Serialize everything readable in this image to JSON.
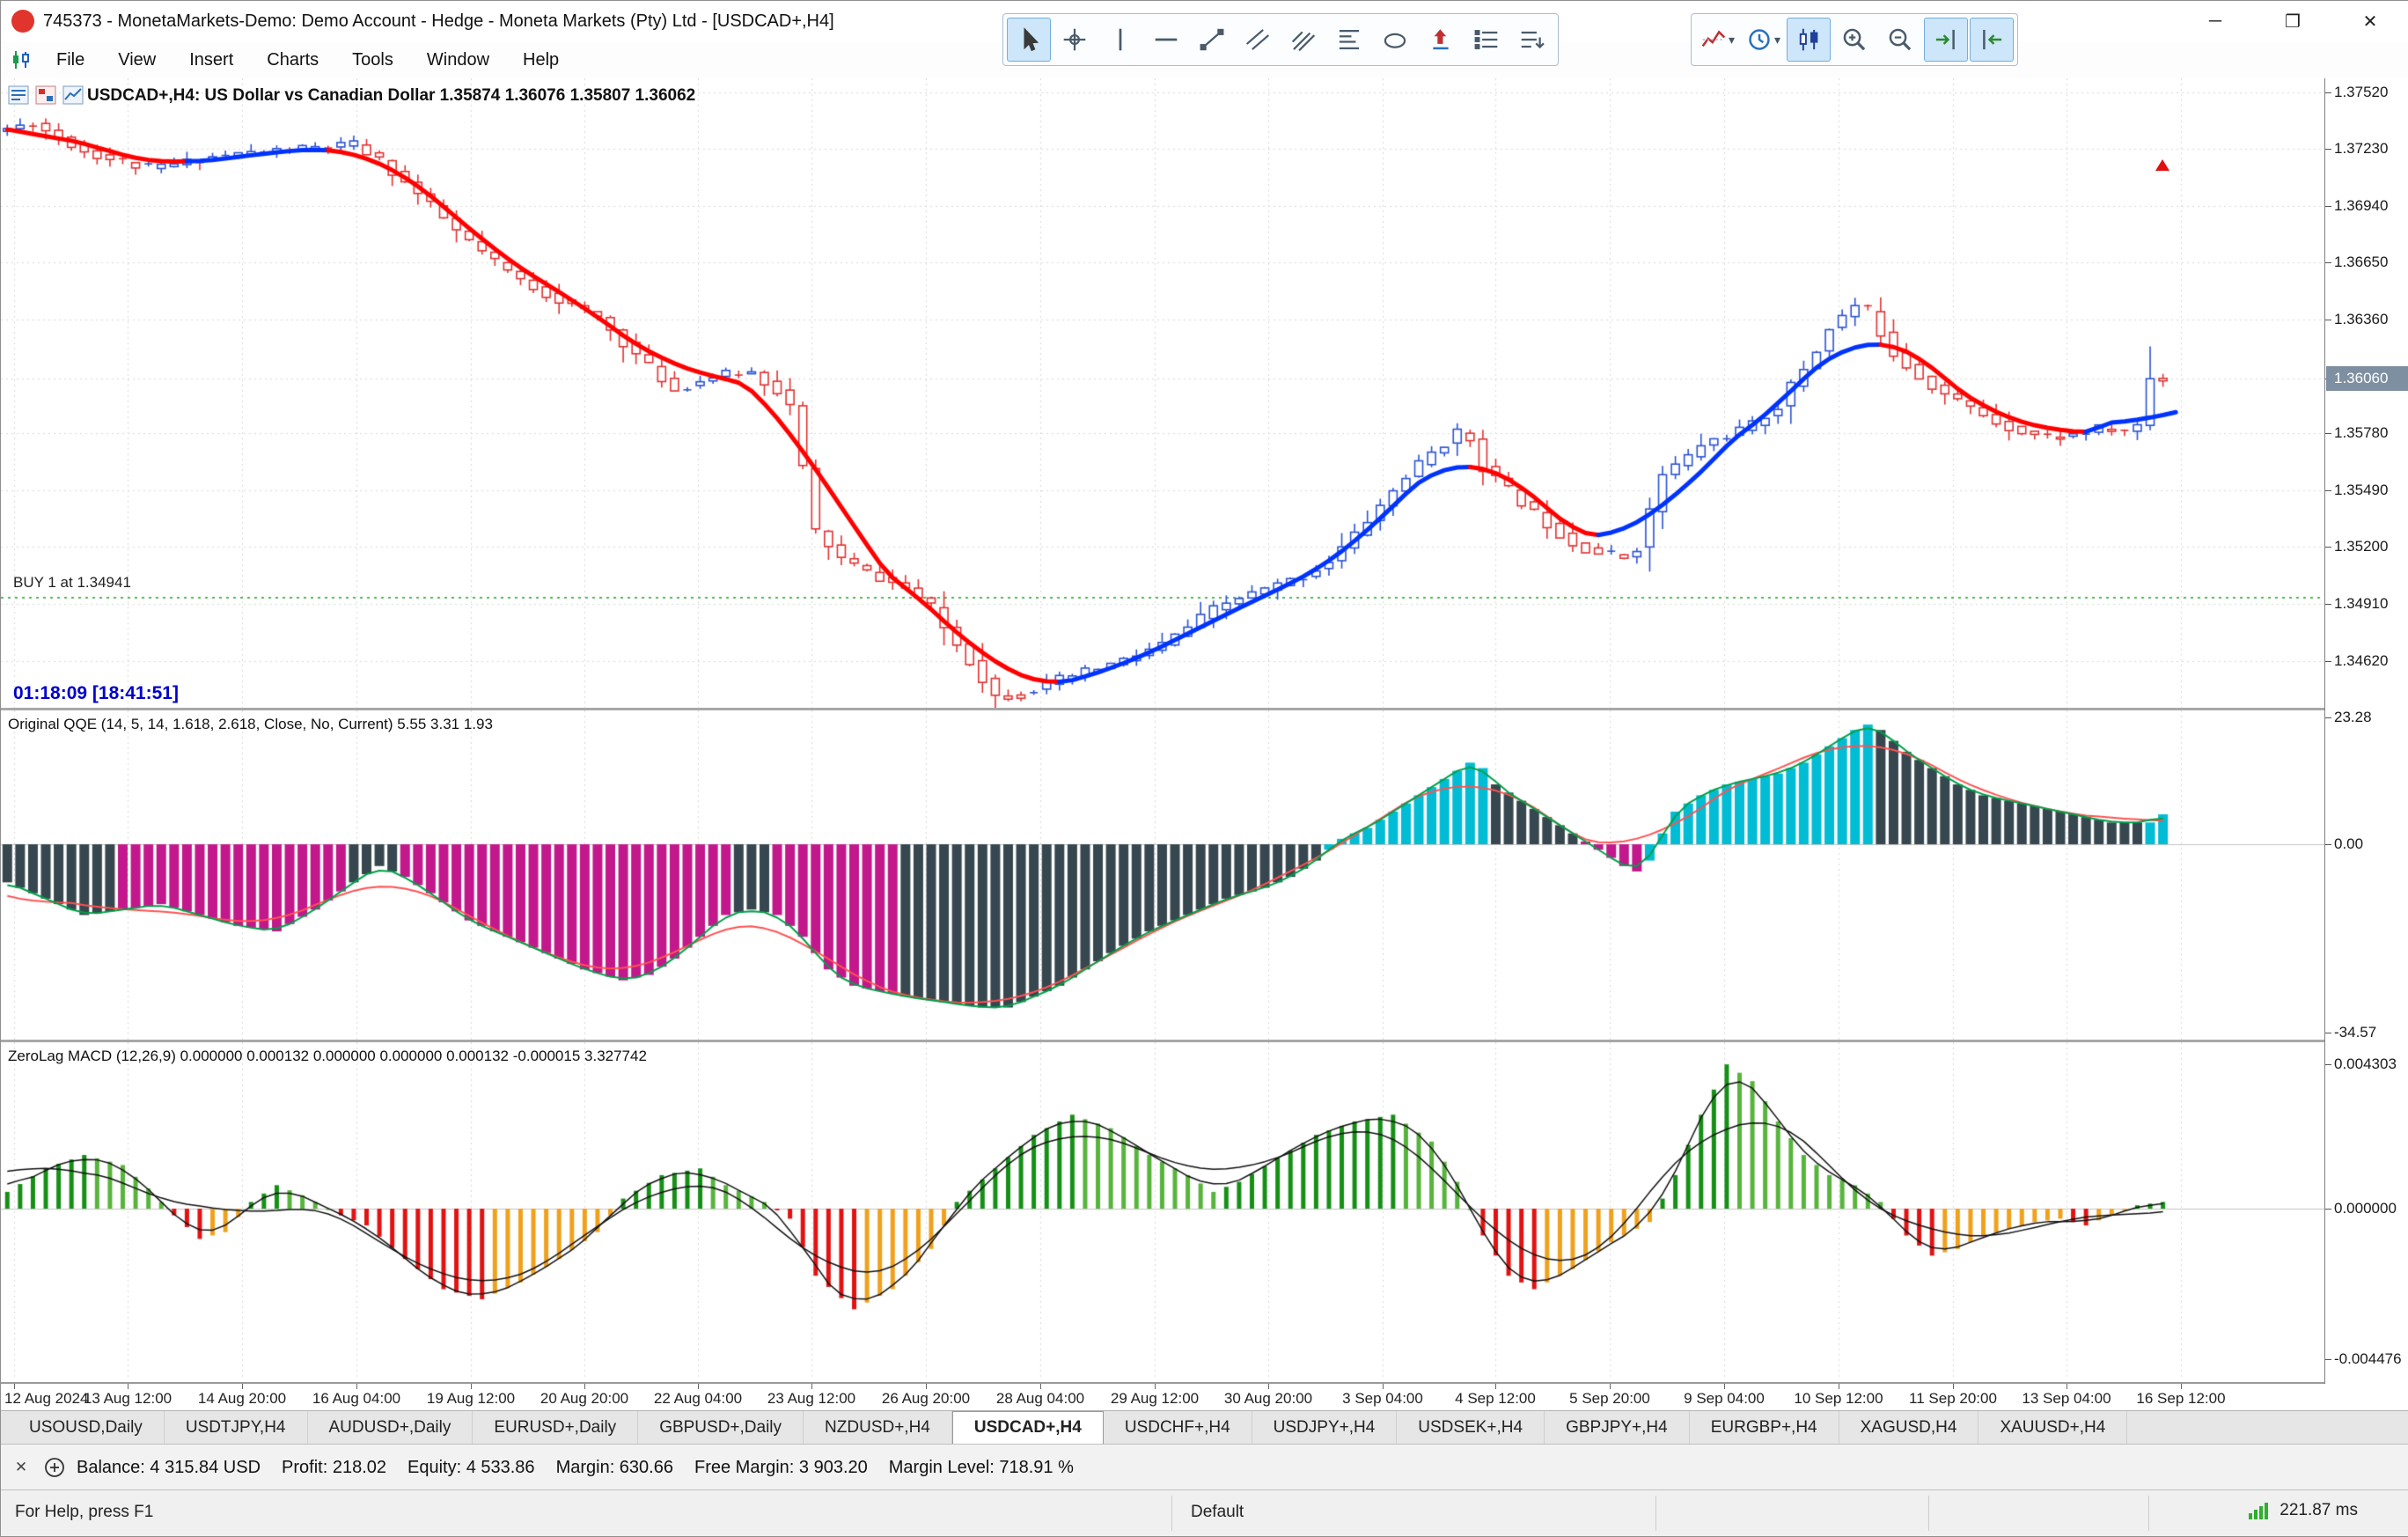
{
  "window": {
    "title": "745373 - MonetaMarkets-Demo: Demo Account - Hedge - Moneta Markets (Pty) Ltd - [USDCAD+,H4]"
  },
  "menu": {
    "items": [
      "File",
      "View",
      "Insert",
      "Charts",
      "Tools",
      "Window",
      "Help"
    ]
  },
  "toolbars": {
    "drawing": [
      {
        "name": "cursor-tool",
        "selected": true
      },
      {
        "name": "crosshair-tool"
      },
      {
        "name": "vertical-line-tool"
      },
      {
        "name": "horizontal-line-tool"
      },
      {
        "name": "trendline-tool"
      },
      {
        "name": "equidistant-channel-tool"
      },
      {
        "name": "andrews-pitchfork-tool"
      },
      {
        "name": "fibonacci-retracement-tool"
      },
      {
        "name": "shapes-tool"
      },
      {
        "name": "arrow-objects-tool"
      },
      {
        "name": "graphical-objects-tool"
      },
      {
        "name": "objects-list-tool"
      }
    ],
    "chart_controls": [
      {
        "name": "indicators-button",
        "dropdown": true
      },
      {
        "name": "timeframes-button",
        "dropdown": true
      },
      {
        "name": "candlestick-mode-button",
        "selected": true
      },
      {
        "name": "zoom-in-button"
      },
      {
        "name": "zoom-out-button"
      },
      {
        "name": "chart-shift-button",
        "selected": true
      },
      {
        "name": "auto-scroll-button",
        "selected": true
      }
    ]
  },
  "chart": {
    "header": "USDCAD+,H4:  US Dollar vs Canadian Dollar  1.35874 1.36076 1.35807 1.36062",
    "buy_label": "BUY 1 at 1.34941",
    "buy_price": 1.34941,
    "timer": "01:18:09 [18:41:51]",
    "current_price_label": "1.36060",
    "current_price": 1.3606
  },
  "indicators": {
    "qqe_title": "Original QQE (14, 5, 14, 1.618, 2.618, Close, No, Current) 5.55 3.31 1.93",
    "macd_title": "ZeroLag MACD (12,26,9) 0.000000 0.000132 0.000000 0.000000 0.000132 -0.000015 3.327742"
  },
  "colors": {
    "candle_up": "#2a52d4",
    "candle_down": "#e33030",
    "ma_up": "#0033ff",
    "ma_down": "#ff0000",
    "buy_line": "#18a018",
    "grid": "#d9d9d9",
    "qqe": {
      "dark": "#37474f",
      "magenta": "#c2188c",
      "cyan": "#00bcd4",
      "line_fast": "#00a048",
      "line_slow": "#ff5252"
    },
    "macd": {
      "pos_rise": "#159015",
      "pos_fall": "#57b43c",
      "neg_fall": "#e31212",
      "neg_rise": "#f0a11c",
      "signal": "#101010"
    }
  },
  "chart_data": [
    {
      "type": "candlestick",
      "title": "USDCAD+,H4 US Dollar vs Canadian Dollar",
      "symbol": "USDCAD+",
      "timeframe": "H4",
      "ohlc_display": {
        "open": "1.35874",
        "high": "1.36076",
        "low": "1.35807",
        "close": "1.36062"
      },
      "bars": 169,
      "visible_fraction": 0.9333,
      "ylim": [
        1.3438,
        1.3759
      ],
      "grid_prices": [
        "1.37520",
        "1.37230",
        "1.36940",
        "1.36650",
        "1.36360",
        "1.36060",
        "1.35780",
        "1.35490",
        "1.35200",
        "1.34910",
        "1.34620"
      ],
      "price_anchors": [
        [
          0,
          1.3732
        ],
        [
          3,
          1.3736
        ],
        [
          5,
          1.3729
        ],
        [
          7,
          1.3722
        ],
        [
          10,
          1.3716
        ],
        [
          12,
          1.3713
        ],
        [
          15,
          1.3716
        ],
        [
          17,
          1.3719
        ],
        [
          20,
          1.3721
        ],
        [
          24,
          1.3723
        ],
        [
          28,
          1.3725
        ],
        [
          30,
          1.3717
        ],
        [
          32,
          1.3706
        ],
        [
          34,
          1.3694
        ],
        [
          36,
          1.3681
        ],
        [
          39,
          1.3665
        ],
        [
          41,
          1.3656
        ],
        [
          44,
          1.3646
        ],
        [
          47,
          1.3637
        ],
        [
          50,
          1.3618
        ],
        [
          53,
          1.36
        ],
        [
          56,
          1.3607
        ],
        [
          59,
          1.3609
        ],
        [
          61,
          1.36
        ],
        [
          62,
          1.3592
        ],
        [
          63,
          1.356
        ],
        [
          64,
          1.3528
        ],
        [
          66,
          1.3514
        ],
        [
          68,
          1.3507
        ],
        [
          71,
          1.3499
        ],
        [
          73,
          1.3489
        ],
        [
          74,
          1.3479
        ],
        [
          76,
          1.3462
        ],
        [
          78,
          1.3444
        ],
        [
          80,
          1.3445
        ],
        [
          82,
          1.345
        ],
        [
          85,
          1.3456
        ],
        [
          88,
          1.3462
        ],
        [
          91,
          1.347
        ],
        [
          93,
          1.3479
        ],
        [
          95,
          1.3488
        ],
        [
          97,
          1.3494
        ],
        [
          99,
          1.3498
        ],
        [
          102,
          1.3505
        ],
        [
          104,
          1.3513
        ],
        [
          106,
          1.3526
        ],
        [
          108,
          1.3541
        ],
        [
          110,
          1.3556
        ],
        [
          112,
          1.3568
        ],
        [
          114,
          1.3578
        ],
        [
          115,
          1.3575
        ],
        [
          116,
          1.3561
        ],
        [
          118,
          1.3549
        ],
        [
          119,
          1.3543
        ],
        [
          121,
          1.3532
        ],
        [
          123,
          1.3522
        ],
        [
          125,
          1.3517
        ],
        [
          127,
          1.3515
        ],
        [
          128,
          1.352
        ],
        [
          129,
          1.3538
        ],
        [
          130,
          1.3557
        ],
        [
          132,
          1.3566
        ],
        [
          133,
          1.3572
        ],
        [
          135,
          1.3577
        ],
        [
          137,
          1.3582
        ],
        [
          139,
          1.3592
        ],
        [
          140,
          1.3602
        ],
        [
          142,
          1.362
        ],
        [
          143,
          1.3632
        ],
        [
          145,
          1.3643
        ],
        [
          146,
          1.364
        ],
        [
          148,
          1.3619
        ],
        [
          150,
          1.3607
        ],
        [
          152,
          1.3598
        ],
        [
          154,
          1.3591
        ],
        [
          156,
          1.3584
        ],
        [
          158,
          1.3579
        ],
        [
          160,
          1.3576
        ],
        [
          162,
          1.3577
        ],
        [
          164,
          1.358
        ],
        [
          166,
          1.3579
        ],
        [
          167,
          1.3582
        ],
        [
          168,
          1.3606
        ]
      ],
      "timeline": {
        "labels": [
          "12 Aug 2024",
          "13 Aug 12:00",
          "14 Aug 20:00",
          "16 Aug 04:00",
          "19 Aug 12:00",
          "20 Aug 20:00",
          "22 Aug 04:00",
          "23 Aug 12:00",
          "26 Aug 20:00",
          "28 Aug 04:00",
          "29 Aug 12:00",
          "30 Aug 20:00",
          "3 Sep 04:00",
          "4 Sep 12:00",
          "5 Sep 20:00",
          "9 Sep 04:00",
          "10 Sep 12:00",
          "11 Sep 20:00",
          "13 Sep 04:00",
          "16 Sep 12:00"
        ],
        "bars": [
          1,
          9.9,
          18.8,
          27.7,
          36.6,
          45.5,
          54.3,
          63.2,
          72.1,
          81,
          89.9,
          98.8,
          107.7,
          116.5,
          125.4,
          134.3,
          143.2,
          152.1,
          161,
          169.9
        ]
      }
    },
    {
      "type": "bar",
      "name": "Original QQE",
      "params": "14, 5, 14, 1.618, 2.618, Close, No, Current",
      "values_display": "5.55 3.31 1.93",
      "ylim": [
        -35.9,
        24.6
      ],
      "scale_labels": [
        [
          "23.28",
          23.28
        ],
        [
          "0.00",
          0
        ],
        [
          "-34.57",
          -34.57
        ]
      ],
      "anchors": [
        [
          0,
          -7
        ],
        [
          3,
          -10
        ],
        [
          6,
          -13
        ],
        [
          9,
          -12
        ],
        [
          12,
          -11
        ],
        [
          15,
          -13
        ],
        [
          18,
          -15
        ],
        [
          21,
          -16
        ],
        [
          24,
          -12
        ],
        [
          27,
          -7
        ],
        [
          29,
          -4
        ],
        [
          31,
          -6
        ],
        [
          33,
          -9
        ],
        [
          36,
          -14
        ],
        [
          39,
          -17
        ],
        [
          42,
          -20
        ],
        [
          45,
          -23
        ],
        [
          48,
          -25
        ],
        [
          50,
          -24
        ],
        [
          52,
          -21
        ],
        [
          54,
          -17
        ],
        [
          56,
          -13
        ],
        [
          58,
          -12
        ],
        [
          60,
          -13
        ],
        [
          62,
          -17
        ],
        [
          64,
          -23
        ],
        [
          66,
          -26
        ],
        [
          68,
          -27
        ],
        [
          70,
          -28
        ],
        [
          73,
          -29
        ],
        [
          76,
          -30
        ],
        [
          78,
          -30
        ],
        [
          80,
          -28
        ],
        [
          82,
          -26
        ],
        [
          84,
          -23
        ],
        [
          86,
          -20
        ],
        [
          89,
          -16
        ],
        [
          92,
          -13
        ],
        [
          95,
          -10
        ],
        [
          98,
          -8
        ],
        [
          100,
          -6
        ],
        [
          102,
          -3
        ],
        [
          104,
          1
        ],
        [
          106,
          3
        ],
        [
          108,
          6
        ],
        [
          110,
          9
        ],
        [
          112,
          12
        ],
        [
          114,
          15
        ],
        [
          115,
          14
        ],
        [
          116,
          11
        ],
        [
          118,
          8
        ],
        [
          120,
          5
        ],
        [
          122,
          2
        ],
        [
          124,
          -1
        ],
        [
          126,
          -4
        ],
        [
          127,
          -5
        ],
        [
          128,
          -3
        ],
        [
          129,
          2
        ],
        [
          130,
          6
        ],
        [
          132,
          9
        ],
        [
          134,
          11
        ],
        [
          136,
          12
        ],
        [
          138,
          13
        ],
        [
          140,
          15
        ],
        [
          142,
          18
        ],
        [
          144,
          21
        ],
        [
          145,
          22
        ],
        [
          146,
          21
        ],
        [
          148,
          17
        ],
        [
          150,
          14
        ],
        [
          152,
          11
        ],
        [
          154,
          9
        ],
        [
          156,
          8
        ],
        [
          158,
          7
        ],
        [
          160,
          6
        ],
        [
          162,
          5
        ],
        [
          164,
          4
        ],
        [
          166,
          4
        ],
        [
          167,
          4
        ],
        [
          168,
          5.5
        ]
      ],
      "color_segments": [
        [
          0,
          9,
          "dark"
        ],
        [
          9,
          27,
          "magenta"
        ],
        [
          27,
          31,
          "dark"
        ],
        [
          31,
          57,
          "magenta"
        ],
        [
          57,
          60,
          "dark"
        ],
        [
          60,
          70,
          "magenta"
        ],
        [
          70,
          103,
          "dark"
        ],
        [
          103,
          116,
          "cyan"
        ],
        [
          116,
          123,
          "dark"
        ],
        [
          123,
          128,
          "magenta"
        ],
        [
          128,
          146,
          "cyan"
        ],
        [
          146,
          167,
          "dark"
        ],
        [
          167,
          169,
          "cyan"
        ]
      ]
    },
    {
      "type": "bar",
      "name": "ZeroLag MACD",
      "params": "12,26,9",
      "ylim": [
        -0.005116,
        0.004959
      ],
      "scale_labels": [
        [
          "0.004303",
          0.004303
        ],
        [
          "0.000000",
          0
        ],
        [
          "-0.004476",
          -0.004476
        ]
      ],
      "anchors": [
        [
          0,
          0.0005
        ],
        [
          3,
          0.0012
        ],
        [
          6,
          0.0016
        ],
        [
          9,
          0.0013
        ],
        [
          11,
          0.0006
        ],
        [
          13,
          -0.0002
        ],
        [
          15,
          -0.0009
        ],
        [
          17,
          -0.0007
        ],
        [
          19,
          0.0002
        ],
        [
          21,
          0.0007
        ],
        [
          23,
          0.0004
        ],
        [
          26,
          -0.0002
        ],
        [
          28,
          -0.0005
        ],
        [
          31,
          -0.0015
        ],
        [
          34,
          -0.0024
        ],
        [
          37,
          -0.0027
        ],
        [
          40,
          -0.0022
        ],
        [
          43,
          -0.0015
        ],
        [
          46,
          -0.0007
        ],
        [
          48,
          0.0003
        ],
        [
          51,
          0.001
        ],
        [
          54,
          0.0012
        ],
        [
          56,
          0.0007
        ],
        [
          59,
          0.0002
        ],
        [
          61,
          -0.0003
        ],
        [
          63,
          -0.002
        ],
        [
          66,
          -0.003
        ],
        [
          69,
          -0.0024
        ],
        [
          72,
          -0.0012
        ],
        [
          74,
          0.0002
        ],
        [
          77,
          0.0012
        ],
        [
          80,
          0.0022
        ],
        [
          83,
          0.0028
        ],
        [
          86,
          0.0024
        ],
        [
          89,
          0.0016
        ],
        [
          92,
          0.001
        ],
        [
          94,
          0.0005
        ],
        [
          96,
          0.0008
        ],
        [
          99,
          0.0015
        ],
        [
          102,
          0.0022
        ],
        [
          105,
          0.0026
        ],
        [
          108,
          0.0028
        ],
        [
          111,
          0.002
        ],
        [
          113,
          0.0008
        ],
        [
          115,
          -0.0008
        ],
        [
          117,
          -0.002
        ],
        [
          119,
          -0.0024
        ],
        [
          122,
          -0.0018
        ],
        [
          125,
          -0.001
        ],
        [
          128,
          -0.0004
        ],
        [
          130,
          0.001
        ],
        [
          132,
          0.0028
        ],
        [
          134,
          0.0043
        ],
        [
          136,
          0.0038
        ],
        [
          138,
          0.0026
        ],
        [
          140,
          0.0016
        ],
        [
          142,
          0.001
        ],
        [
          144,
          0.0007
        ],
        [
          146,
          0.0002
        ],
        [
          148,
          -0.0008
        ],
        [
          150,
          -0.0014
        ],
        [
          152,
          -0.0012
        ],
        [
          154,
          -0.0008
        ],
        [
          156,
          -0.0006
        ],
        [
          158,
          -0.0004
        ],
        [
          160,
          -0.0003
        ],
        [
          162,
          -0.0005
        ],
        [
          164,
          -0.0002
        ],
        [
          166,
          0.0001
        ],
        [
          168,
          0.0002
        ]
      ]
    }
  ],
  "tabs": {
    "items": [
      "USOUSD,Daily",
      "USDTJPY,H4",
      "AUDUSD+,Daily",
      "EURUSD+,Daily",
      "GBPUSD+,Daily",
      "NZDUSD+,H4",
      "USDCAD+,H4",
      "USDCHF+,H4",
      "USDJPY+,H4",
      "USDSEK+,H4",
      "GBPJPY+,H4",
      "EURGBP+,H4",
      "XAGUSD,H4",
      "XAUUSD+,H4"
    ],
    "active": "USDCAD+,H4"
  },
  "toolbox": {
    "segments": [
      "Balance: 4 315.84 USD",
      "Profit: 218.02",
      "Equity: 4 533.86",
      "Margin: 630.66",
      "Free Margin: 3 903.20",
      "Margin Level: 718.91 %"
    ]
  },
  "statusbar": {
    "help": "For Help, press F1",
    "profile": "Default",
    "latency": "221.87 ms"
  }
}
